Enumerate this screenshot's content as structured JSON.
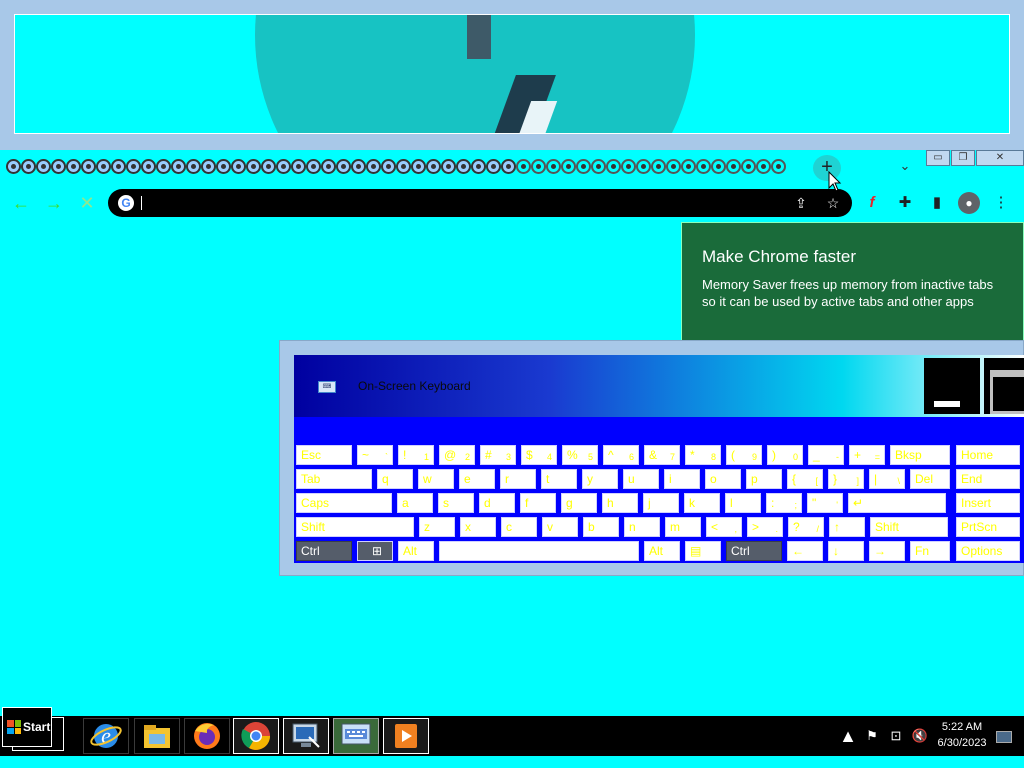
{
  "browser": {
    "tabs_count_visible": 52,
    "new_tab_label": "+",
    "tab_search_label": "⌄",
    "window_buttons": {
      "minimize": "▭",
      "restore": "❐",
      "close": "✕"
    },
    "toolbar": {
      "back": "←",
      "forward": "→",
      "stop": "✕",
      "omnibox_value": "",
      "google_logo": "G",
      "share_icon": "⇪",
      "bookmark_icon": "☆",
      "flash_icon": "f",
      "extensions_icon": "✚",
      "sidepanel_icon": "▮",
      "profile_icon": "●",
      "menu_icon": "⋮"
    },
    "promo": {
      "title": "Make Chrome faster",
      "body": "Memory Saver frees up memory from inactive tabs so it can be used by active tabs and other apps"
    }
  },
  "osk": {
    "title": "On-Screen Keyboard",
    "rows": [
      [
        {
          "label": "Esc",
          "sub": ""
        },
        {
          "label": "~",
          "sub": "`"
        },
        {
          "label": "!",
          "sub": "1"
        },
        {
          "label": "@",
          "sub": "2"
        },
        {
          "label": "#",
          "sub": "3"
        },
        {
          "label": "$",
          "sub": "4"
        },
        {
          "label": "%",
          "sub": "5"
        },
        {
          "label": "^",
          "sub": "6"
        },
        {
          "label": "&",
          "sub": "7"
        },
        {
          "label": "*",
          "sub": "8"
        },
        {
          "label": "(",
          "sub": "9"
        },
        {
          "label": ")",
          "sub": "0"
        },
        {
          "label": "_",
          "sub": "-"
        },
        {
          "label": "+",
          "sub": "="
        },
        {
          "label": "Bksp",
          "sub": ""
        },
        {
          "label": "Home",
          "sub": ""
        }
      ],
      [
        {
          "label": "Tab",
          "sub": ""
        },
        {
          "label": "q",
          "sub": ""
        },
        {
          "label": "w",
          "sub": ""
        },
        {
          "label": "e",
          "sub": ""
        },
        {
          "label": "r",
          "sub": ""
        },
        {
          "label": "t",
          "sub": ""
        },
        {
          "label": "y",
          "sub": ""
        },
        {
          "label": "u",
          "sub": ""
        },
        {
          "label": "i",
          "sub": ""
        },
        {
          "label": "o",
          "sub": ""
        },
        {
          "label": "p",
          "sub": ""
        },
        {
          "label": "{",
          "sub": "["
        },
        {
          "label": "}",
          "sub": "]"
        },
        {
          "label": "|",
          "sub": "\\"
        },
        {
          "label": "Del",
          "sub": ""
        },
        {
          "label": "End",
          "sub": ""
        }
      ],
      [
        {
          "label": "Caps",
          "sub": ""
        },
        {
          "label": "a",
          "sub": ""
        },
        {
          "label": "s",
          "sub": ""
        },
        {
          "label": "d",
          "sub": ""
        },
        {
          "label": "f",
          "sub": ""
        },
        {
          "label": "g",
          "sub": ""
        },
        {
          "label": "h",
          "sub": ""
        },
        {
          "label": "j",
          "sub": ""
        },
        {
          "label": "k",
          "sub": ""
        },
        {
          "label": "l",
          "sub": ""
        },
        {
          "label": ":",
          "sub": ";"
        },
        {
          "label": "\"",
          "sub": "'"
        },
        {
          "label": "↵",
          "sub": ""
        },
        {
          "label": "Insert",
          "sub": ""
        }
      ],
      [
        {
          "label": "Shift",
          "sub": ""
        },
        {
          "label": "z",
          "sub": ""
        },
        {
          "label": "x",
          "sub": ""
        },
        {
          "label": "c",
          "sub": ""
        },
        {
          "label": "v",
          "sub": ""
        },
        {
          "label": "b",
          "sub": ""
        },
        {
          "label": "n",
          "sub": ""
        },
        {
          "label": "m",
          "sub": ""
        },
        {
          "label": "<",
          "sub": ","
        },
        {
          "label": ">",
          "sub": "."
        },
        {
          "label": "?",
          "sub": "/"
        },
        {
          "label": "↑",
          "sub": ""
        },
        {
          "label": "Shift",
          "sub": ""
        },
        {
          "label": "PrtScn",
          "sub": ""
        }
      ],
      [
        {
          "label": "Ctrl",
          "sub": ""
        },
        {
          "label": "⊞",
          "sub": ""
        },
        {
          "label": "Alt",
          "sub": ""
        },
        {
          "label": "",
          "sub": ""
        },
        {
          "label": "Alt",
          "sub": ""
        },
        {
          "label": "▤",
          "sub": ""
        },
        {
          "label": "Ctrl",
          "sub": ""
        },
        {
          "label": "←",
          "sub": ""
        },
        {
          "label": "↓",
          "sub": ""
        },
        {
          "label": "→",
          "sub": ""
        },
        {
          "label": "Fn",
          "sub": ""
        },
        {
          "label": "Options",
          "sub": ""
        }
      ]
    ]
  },
  "taskbar": {
    "start_label": "Start",
    "pinned": [
      {
        "name": "internet-explorer",
        "glyph": "e"
      },
      {
        "name": "file-explorer",
        "glyph": "▤"
      },
      {
        "name": "firefox",
        "glyph": "●"
      },
      {
        "name": "chrome",
        "glyph": "◉"
      },
      {
        "name": "remote-desktop",
        "glyph": "▣"
      },
      {
        "name": "on-screen-keyboard",
        "glyph": "⌨"
      },
      {
        "name": "media-player",
        "glyph": "▶"
      }
    ],
    "tray": {
      "chevron": "▲",
      "flag": "⚑",
      "network": "⊡",
      "volume": "🔇"
    },
    "clock_time": "5:22 AM",
    "clock_date": "6/30/2023"
  }
}
